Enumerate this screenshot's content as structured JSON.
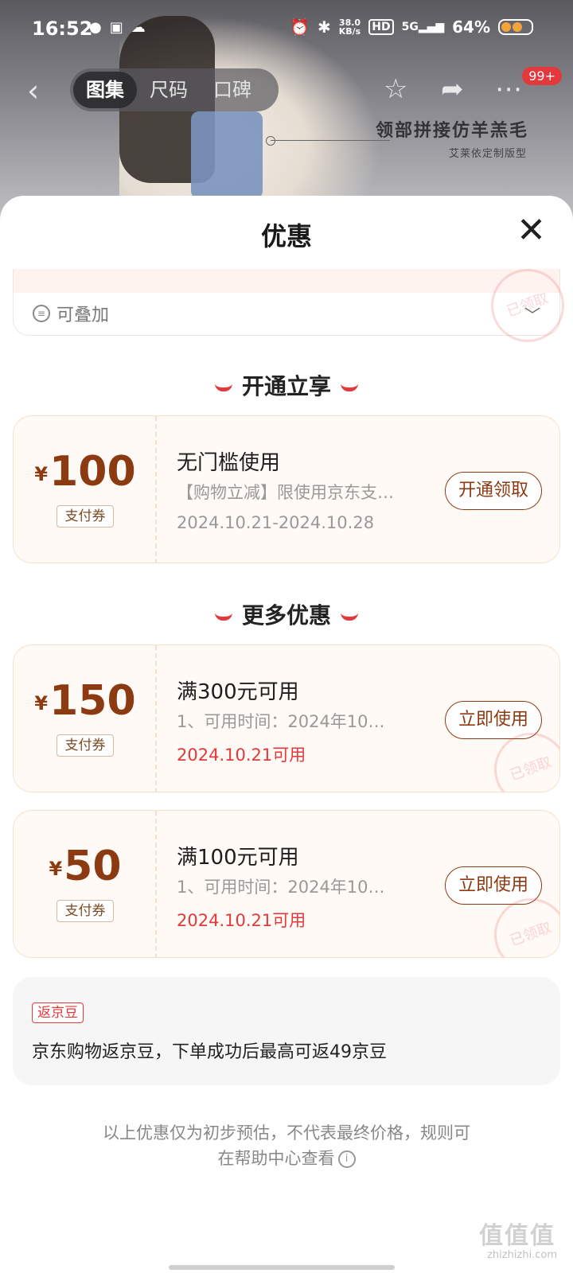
{
  "status_bar": {
    "time": "16:52",
    "speed_top": "38.0",
    "speed_bottom": "KB/s",
    "hd": "HD",
    "network": "5G",
    "battery_text": "64%"
  },
  "nav": {
    "tabs": [
      {
        "label": "图集"
      },
      {
        "label": "尺码"
      },
      {
        "label": "口碑"
      }
    ],
    "badge": "99+"
  },
  "product_banner": {
    "title": "领部拼接仿羊羔毛",
    "subtitle": "艾莱依定制版型"
  },
  "sheet": {
    "title": "优惠",
    "stackable_label": "可叠加",
    "section_open": "开通立享",
    "section_more": "更多优惠",
    "coupons_open": [
      {
        "currency": "¥",
        "amount": "100",
        "tag": "支付券",
        "title": "无门槛使用",
        "desc": "【购物立减】限使用京东支…",
        "date": "2024.10.21-2024.10.28",
        "button": "开通领取"
      }
    ],
    "coupons_more": [
      {
        "currency": "¥",
        "amount": "150",
        "tag": "支付券",
        "title": "满300元可用",
        "desc": "1、可用时间：2024年10…",
        "date": "2024.10.21可用",
        "button": "立即使用",
        "stamp": "已领取"
      },
      {
        "currency": "¥",
        "amount": "50",
        "tag": "支付券",
        "title": "满100元可用",
        "desc": "1、可用时间：2024年10…",
        "date": "2024.10.21可用",
        "button": "立即使用",
        "stamp": "已领取"
      }
    ],
    "prev_stamp": "已领取",
    "jd_bean": {
      "tag": "返京豆",
      "text": "京东购物返京豆，下单成功后最高可返49京豆"
    },
    "footnote_line1": "以上优惠仅为初步预估，不代表最终价格，规则可",
    "footnote_line2": "在帮助中心查看"
  },
  "watermark": {
    "main": "值值值",
    "sub": "zhizhizhi.com"
  },
  "colors": {
    "accent_red": "#e4393c",
    "coupon_brown": "#8b3a12",
    "coupon_bg": "#fffaf5"
  }
}
